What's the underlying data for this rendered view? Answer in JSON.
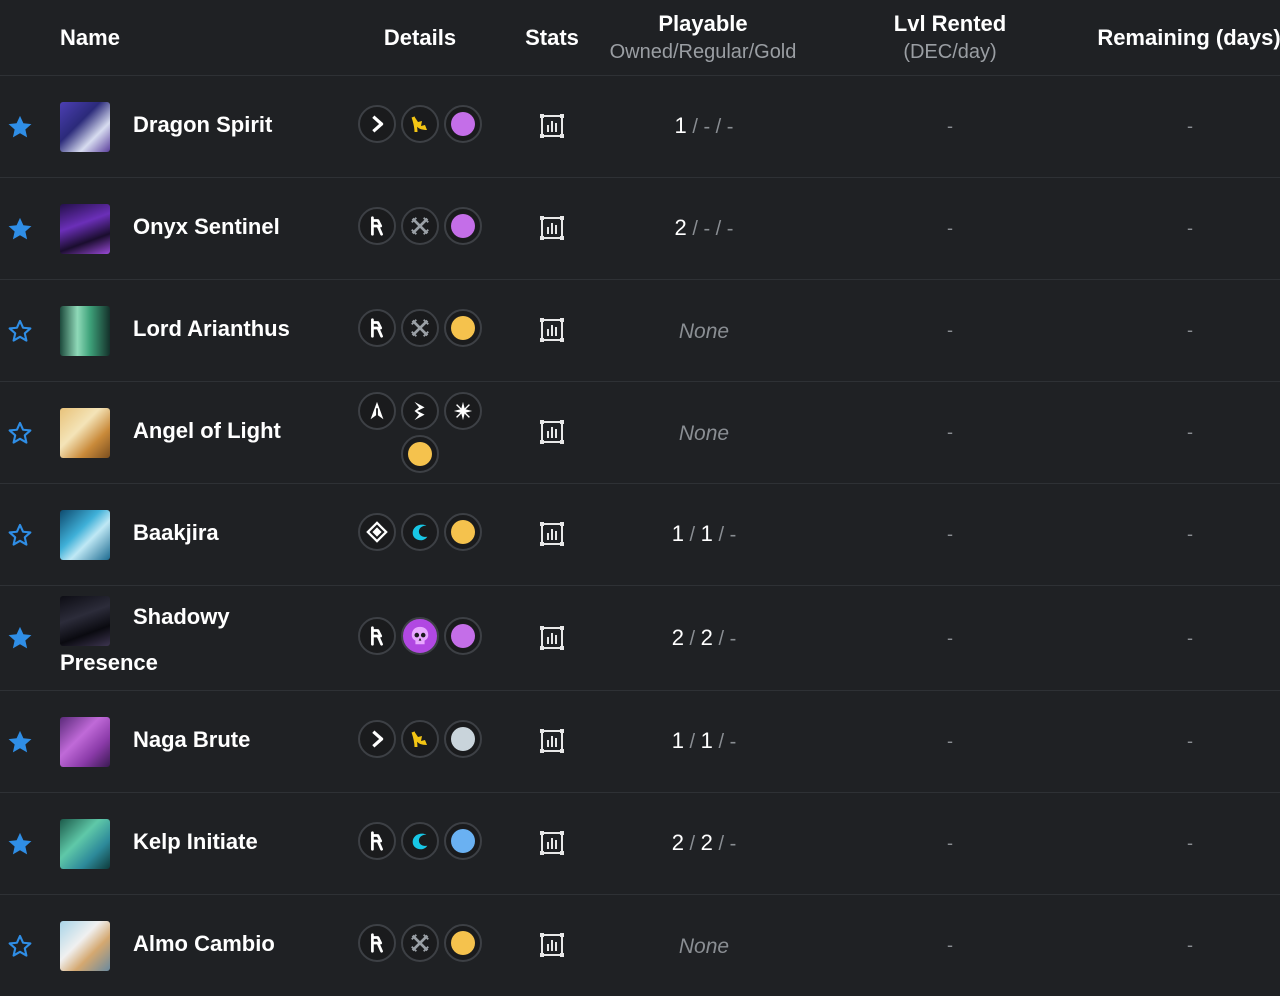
{
  "header": {
    "name": "Name",
    "details": "Details",
    "stats": "Stats",
    "playable": "Playable",
    "playable_sub": "Owned/Regular/Gold",
    "lvl_rented": "Lvl Rented",
    "lvl_rented_sub": "(DEC/day)",
    "remaining": "Remaining (days)"
  },
  "colors": {
    "background": "#1f2124",
    "star_blue": "#2f8ee6",
    "purple": "#c46ee8",
    "gold": "#f5c24d",
    "silver": "#c9d4db",
    "blue": "#6ab1f2",
    "yellow_ability": "#f3c514",
    "cyan_ability": "#18c7e6",
    "pink_ability": "#b148e2"
  },
  "cards": [
    {
      "name": "Dragon Spirit",
      "favorite": true,
      "thumb": "dragon-spirit-thumbnail",
      "abilities": [
        "chevron-right-icon",
        "yellow-ability-icon"
      ],
      "rarity": "purple",
      "owned": "1",
      "regular": "-",
      "gold": "-",
      "lvl_rented": "-",
      "remaining": "-"
    },
    {
      "name": "Onyx Sentinel",
      "favorite": true,
      "thumb": "onyx-sentinel-thumbnail",
      "abilities": [
        "runner-icon",
        "crossed-swords-icon"
      ],
      "rarity": "purple",
      "owned": "2",
      "regular": "-",
      "gold": "-",
      "lvl_rented": "-",
      "remaining": "-"
    },
    {
      "name": "Lord Arianthus",
      "favorite": false,
      "thumb": "lord-arianthus-thumbnail",
      "abilities": [
        "runner-icon",
        "crossed-swords-icon"
      ],
      "rarity": "gold",
      "playable_none": "None",
      "lvl_rented": "-",
      "remaining": "-"
    },
    {
      "name": "Angel of Light",
      "favorite": false,
      "thumb": "angel-of-light-thumbnail",
      "abilities": [
        "arrow-up-icon",
        "lightning-icon",
        "sparkle-icon"
      ],
      "rarity": "gold",
      "playable_none": "None",
      "lvl_rented": "-",
      "remaining": "-"
    },
    {
      "name": "Baakjira",
      "favorite": false,
      "thumb": "baakjira-thumbnail",
      "abilities": [
        "diamond-cross-icon",
        "wave-icon"
      ],
      "rarity": "gold",
      "owned": "1",
      "regular": "1",
      "gold": "-",
      "lvl_rented": "-",
      "remaining": "-"
    },
    {
      "name": "Shadowy Presence",
      "name_line1": "Shadowy",
      "name_line2": "Presence",
      "favorite": true,
      "thumb": "shadowy-presence-thumbnail",
      "abilities": [
        "runner-icon",
        "skull-icon"
      ],
      "rarity": "purple",
      "owned": "2",
      "regular": "2",
      "gold": "-",
      "lvl_rented": "-",
      "remaining": "-"
    },
    {
      "name": "Naga Brute",
      "favorite": true,
      "thumb": "naga-brute-thumbnail",
      "abilities": [
        "chevron-right-icon",
        "yellow-ability-icon"
      ],
      "rarity": "silver",
      "owned": "1",
      "regular": "1",
      "gold": "-",
      "lvl_rented": "-",
      "remaining": "-"
    },
    {
      "name": "Kelp Initiate",
      "favorite": true,
      "thumb": "kelp-initiate-thumbnail",
      "abilities": [
        "runner-icon",
        "wave-icon"
      ],
      "rarity": "blue",
      "owned": "2",
      "regular": "2",
      "gold": "-",
      "lvl_rented": "-",
      "remaining": "-"
    },
    {
      "name": "Almo Cambio",
      "favorite": false,
      "thumb": "almo-cambio-thumbnail",
      "abilities": [
        "runner-icon",
        "crossed-swords-icon"
      ],
      "rarity": "gold",
      "playable_none": "None",
      "lvl_rented": "-",
      "remaining": "-"
    }
  ]
}
